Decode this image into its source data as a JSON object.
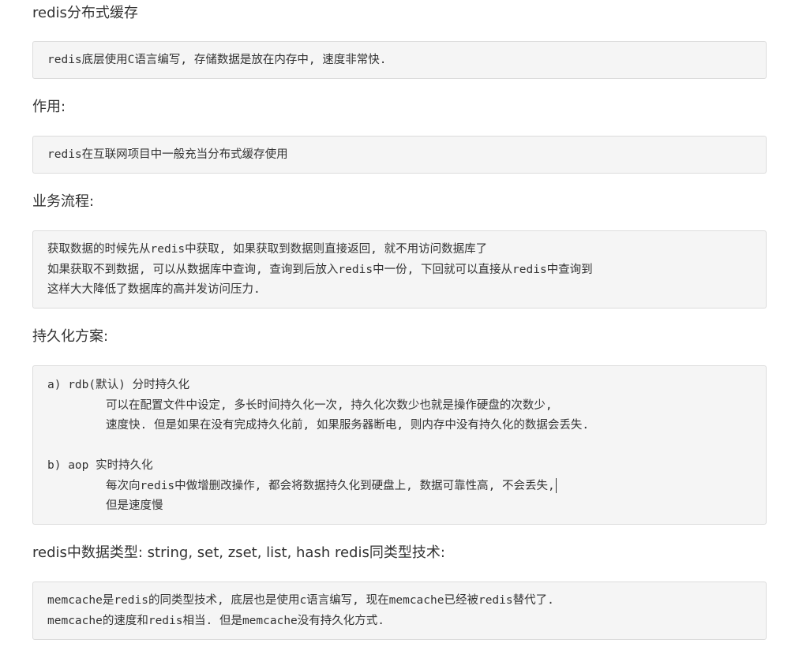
{
  "sections": [
    {
      "heading": "redis分布式缓存",
      "lines": [
        "redis底层使用C语言编写, 存储数据是放在内存中, 速度非常快."
      ]
    },
    {
      "heading": "作用:",
      "lines": [
        "redis在互联网项目中一般充当分布式缓存使用"
      ]
    },
    {
      "heading": "业务流程:",
      "lines": [
        "获取数据的时候先从redis中获取, 如果获取到数据则直接返回, 就不用访问数据库了",
        "如果获取不到数据, 可以从数据库中查询, 查询到后放入redis中一份, 下回就可以直接从redis中查询到",
        "这样大大降低了数据库的高并发访问压力."
      ]
    },
    {
      "heading": "持久化方案:",
      "lines": [
        "a) rdb(默认) 分时持久化",
        "可以在配置文件中设定, 多长时间持久化一次, 持久化次数少也就是操作硬盘的次数少,",
        "速度快. 但是如果在没有完成持久化前, 如果服务器断电, 则内存中没有持久化的数据会丢失.",
        "",
        "b) aop 实时持久化",
        "每次向redis中做增删改操作, 都会将数据持久化到硬盘上, 数据可靠性高, 不会丢失,",
        "但是速度慢"
      ]
    },
    {
      "heading": "redis中数据类型: string, set, zset, list, hash redis同类型技术:",
      "lines": [
        "memcache是redis的同类型技术, 底层也是使用c语言编写, 现在memcache已经被redis替代了.",
        "memcache的速度和redis相当. 但是memcache没有持久化方式."
      ]
    }
  ]
}
